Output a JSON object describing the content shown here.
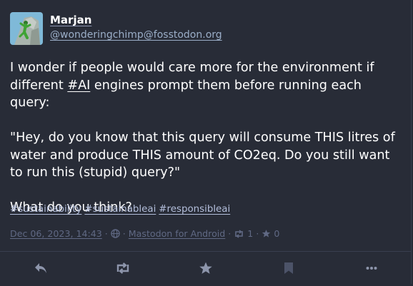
{
  "account": {
    "display_name": "Marjan",
    "acct": "@wonderingchimp@fosstodon.org"
  },
  "content": {
    "p1_before": "I wonder if people would care more for the environment if different ",
    "p1_hashtag": "#AI",
    "p1_after": " engines prompt them before running each query:",
    "p2": "\"Hey, do you know that this query will consume THIS litres of water and produce THIS amount of CO2eq. Do you still want to run this (stupid) query?\"",
    "p3": "What do you think?"
  },
  "hashtags": [
    "#sustainability",
    "#sustainableai",
    "#responsibleai"
  ],
  "meta": {
    "date": "Dec 06, 2023, 14:43",
    "separator": "·",
    "application": "Mastodon for Android",
    "boosts": "1",
    "favourites": "0"
  },
  "actions": [
    "reply-icon",
    "boost-icon",
    "favourite-icon",
    "bookmark-icon",
    "more-icon"
  ],
  "colors": {
    "background": "#282c37",
    "secondary_text": "#9baec8",
    "muted_text": "#606984",
    "action_icon": "#8d95ab"
  }
}
